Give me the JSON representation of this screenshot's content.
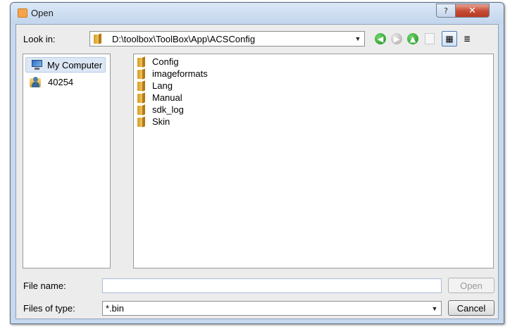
{
  "window": {
    "title": "Open",
    "help_glyph": "?",
    "close_glyph": "✕"
  },
  "toolbar": {
    "look_in_label": "Look in:",
    "path": "D:\\toolbox\\ToolBox\\App\\ACSConfig",
    "dropdown_glyph": "▼",
    "back_glyph": "◀",
    "forward_glyph": "▶",
    "up_glyph": "▲",
    "detail_view_glyph": "▦",
    "list_view_glyph": "≣"
  },
  "sidebar": {
    "items": [
      {
        "label": "My Computer",
        "icon": "computer-icon"
      },
      {
        "label": "40254",
        "icon": "user-folder-icon"
      }
    ]
  },
  "files": [
    {
      "name": "Config",
      "icon": "folder-icon"
    },
    {
      "name": "imageformats",
      "icon": "folder-icon"
    },
    {
      "name": "Lang",
      "icon": "folder-icon"
    },
    {
      "name": "Manual",
      "icon": "folder-icon"
    },
    {
      "name": "sdk_log",
      "icon": "folder-icon"
    },
    {
      "name": "Skin",
      "icon": "folder-icon"
    }
  ],
  "footer": {
    "filename_label": "File name:",
    "filename_value": "",
    "filetype_label": "Files of type:",
    "filetype_value": "*.bin",
    "open_button": "Open",
    "cancel_button": "Cancel"
  },
  "colors": {
    "window_frame": "#c7d9ee",
    "close_button": "#c44a32",
    "nav_green": "#1f8e1c",
    "folder": "#d79c28"
  }
}
